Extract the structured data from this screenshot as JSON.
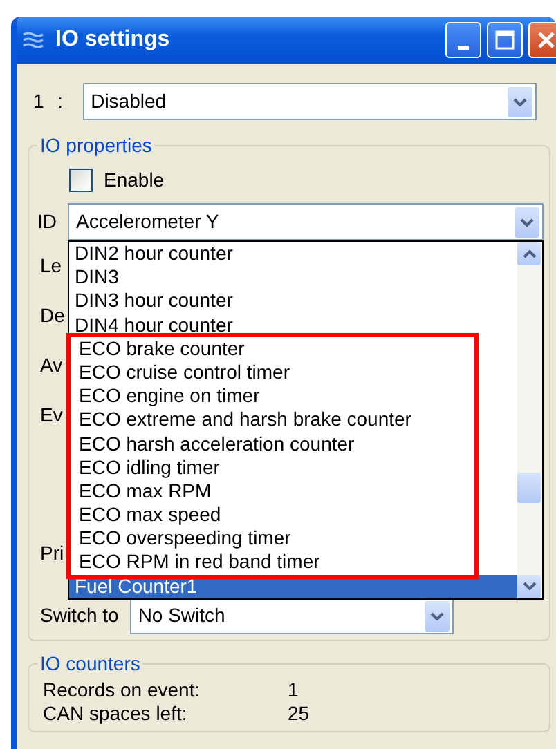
{
  "window": {
    "title": "IO settings"
  },
  "title_buttons": [
    {
      "kind": "minimize"
    },
    {
      "kind": "maximize"
    },
    {
      "kind": "close"
    }
  ],
  "channel": {
    "label": "1 :",
    "value": "Disabled"
  },
  "io_properties": {
    "title": "IO properties",
    "enable": {
      "label": "Enable",
      "checked": false
    },
    "id": {
      "label": "ID",
      "value": "Accelerometer Y"
    },
    "obscured_labels": [
      "Le",
      "De",
      "Av",
      "Ev",
      "Pri"
    ],
    "id_dropdown": {
      "items": [
        {
          "label": "DIN2 hour counter",
          "selected": false,
          "highlighted": false
        },
        {
          "label": "DIN3",
          "selected": false,
          "highlighted": false
        },
        {
          "label": "DIN3 hour counter",
          "selected": false,
          "highlighted": false
        },
        {
          "label": "DIN4 hour counter",
          "selected": false,
          "highlighted": false
        },
        {
          "label": "ECO brake counter",
          "selected": false,
          "highlighted": true
        },
        {
          "label": "ECO cruise control timer",
          "selected": false,
          "highlighted": true
        },
        {
          "label": "ECO engine on timer",
          "selected": false,
          "highlighted": true
        },
        {
          "label": "ECO extreme and harsh brake counter",
          "selected": false,
          "highlighted": true
        },
        {
          "label": "ECO harsh acceleration counter",
          "selected": false,
          "highlighted": true
        },
        {
          "label": "ECO idling timer",
          "selected": false,
          "highlighted": true
        },
        {
          "label": "ECO max RPM",
          "selected": false,
          "highlighted": true
        },
        {
          "label": "ECO max speed",
          "selected": false,
          "highlighted": true
        },
        {
          "label": "ECO overspeeding timer",
          "selected": false,
          "highlighted": true
        },
        {
          "label": "ECO RPM in red band timer",
          "selected": false,
          "highlighted": true
        },
        {
          "label": "Fuel Counter1",
          "selected": true,
          "highlighted": false
        }
      ]
    },
    "switch_to": {
      "label": "Switch to",
      "value": "No Switch"
    }
  },
  "io_counters": {
    "title": "IO counters",
    "rows": [
      {
        "label": "Records on event:",
        "value": "1"
      },
      {
        "label": "CAN spaces left:",
        "value": "25"
      }
    ]
  }
}
